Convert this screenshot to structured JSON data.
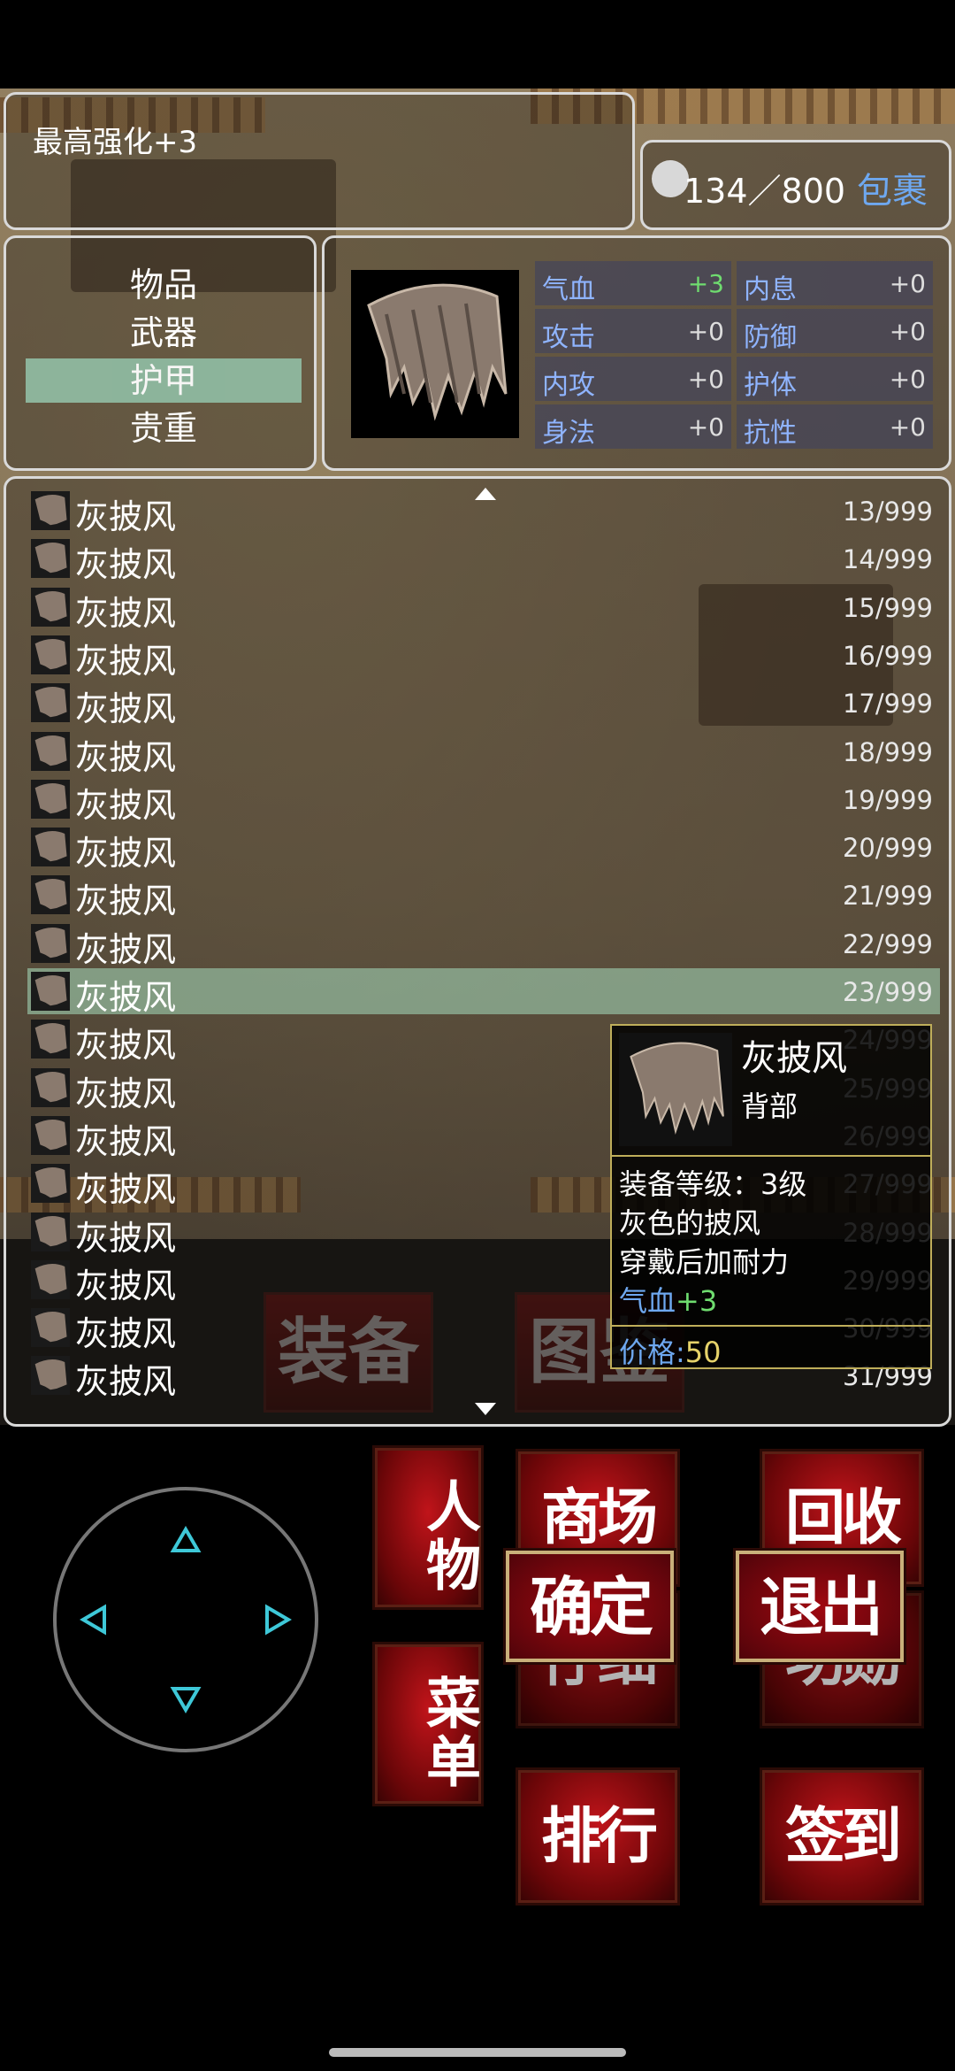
{
  "enhance": {
    "text": "最高强化+3"
  },
  "bag": {
    "count": "134／800",
    "label": "包裹"
  },
  "categories": [
    {
      "label": "物品",
      "selected": false
    },
    {
      "label": "武器",
      "selected": false
    },
    {
      "label": "护甲",
      "selected": true
    },
    {
      "label": "贵重",
      "selected": false
    }
  ],
  "stats": [
    [
      {
        "k": "气血",
        "v": "+3"
      },
      {
        "k": "内息",
        "v": "+0"
      }
    ],
    [
      {
        "k": "攻击",
        "v": "+0"
      },
      {
        "k": "防御",
        "v": "+0"
      }
    ],
    [
      {
        "k": "内攻",
        "v": "+0"
      },
      {
        "k": "护体",
        "v": "+0"
      }
    ],
    [
      {
        "k": "身法",
        "v": "+0"
      },
      {
        "k": "抗性",
        "v": "+0"
      }
    ]
  ],
  "items": [
    {
      "name": "灰披风",
      "count": "13/999"
    },
    {
      "name": "灰披风",
      "count": "14/999"
    },
    {
      "name": "灰披风",
      "count": "15/999"
    },
    {
      "name": "灰披风",
      "count": "16/999"
    },
    {
      "name": "灰披风",
      "count": "17/999"
    },
    {
      "name": "灰披风",
      "count": "18/999"
    },
    {
      "name": "灰披风",
      "count": "19/999"
    },
    {
      "name": "灰披风",
      "count": "20/999"
    },
    {
      "name": "灰披风",
      "count": "21/999"
    },
    {
      "name": "灰披风",
      "count": "22/999"
    },
    {
      "name": "灰披风",
      "count": "23/999"
    },
    {
      "name": "灰披风",
      "count": "24/999"
    },
    {
      "name": "灰披风",
      "count": "25/999"
    },
    {
      "name": "灰披风",
      "count": "26/999"
    },
    {
      "name": "灰披风",
      "count": "27/999"
    },
    {
      "name": "灰披风",
      "count": "28/999"
    },
    {
      "name": "灰披风",
      "count": "29/999"
    },
    {
      "name": "灰披风",
      "count": "30/999"
    },
    {
      "name": "灰披风",
      "count": "31/999"
    }
  ],
  "selected_index": 10,
  "tooltip": {
    "name": "灰披风",
    "slot": "背部",
    "level": "装备等级：3级",
    "desc1": "灰色的披风",
    "desc2": "穿戴后加耐力",
    "bonus_key": "气血",
    "bonus_val": "+3",
    "price_key": "价格:",
    "price_val": "50"
  },
  "ghost_menu": [
    "装备",
    "图鉴"
  ],
  "buttons": {
    "character": "人物",
    "shop": "商场",
    "recycle": "回收",
    "confirm": "确定",
    "exit": "退出",
    "menu": "菜单",
    "rank": "排行",
    "checkin": "签到",
    "hidden1": "仔细",
    "hidden2": "功勋"
  },
  "colors": {
    "accent_blue": "#6ea8f0",
    "bonus_green": "#6fdc6f",
    "price_yellow": "#e6d36a",
    "button_red": "#b5121a"
  },
  "icons": {
    "item": "gray-cape-icon",
    "joystick": "dpad-icon"
  }
}
